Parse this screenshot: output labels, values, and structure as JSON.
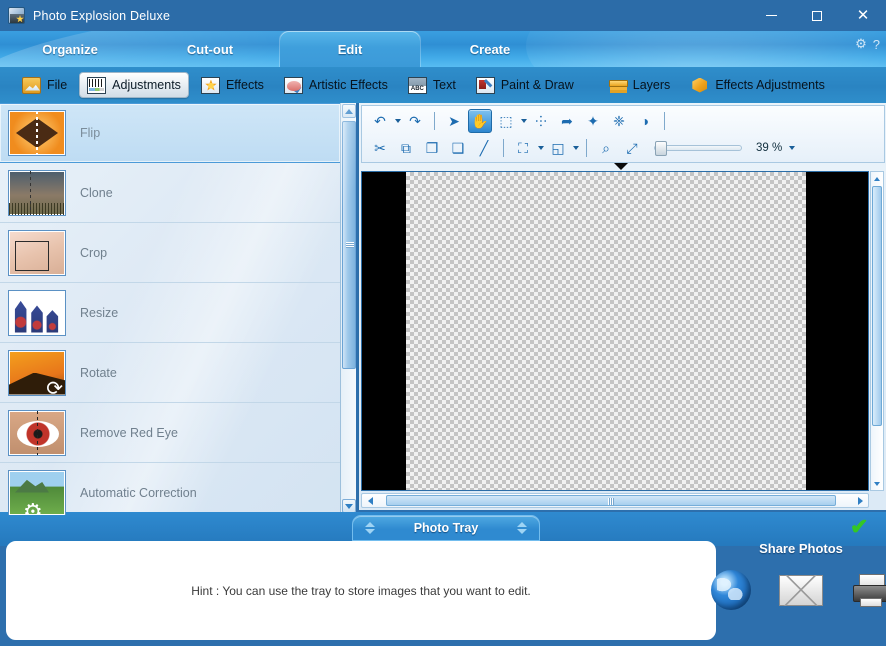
{
  "window": {
    "title": "Photo Explosion Deluxe",
    "app_icon": "photo-app-icon",
    "minimize_label": "—",
    "maximize_label": "❐",
    "close_label": "✕"
  },
  "nav": {
    "tabs": [
      {
        "label": "Organize",
        "active": false
      },
      {
        "label": "Cut-out",
        "active": false
      },
      {
        "label": "Edit",
        "active": true
      },
      {
        "label": "Create",
        "active": false
      }
    ],
    "settings_icon": "gear-icon",
    "help_icon": "question-mark-icon",
    "help_label": "?"
  },
  "ribbon": {
    "items": [
      {
        "label": "File",
        "icon": "file-icon",
        "selected": false
      },
      {
        "label": "Adjustments",
        "icon": "adjustments-histogram-icon",
        "selected": true
      },
      {
        "label": "Effects",
        "icon": "effects-star-icon",
        "selected": false
      },
      {
        "label": "Artistic Effects",
        "icon": "artistic-effects-palette-icon",
        "selected": false
      },
      {
        "label": "Text",
        "icon": "text-abc-icon",
        "selected": false
      },
      {
        "label": "Paint & Draw",
        "icon": "paint-draw-icon",
        "selected": false
      },
      {
        "label": "Layers",
        "icon": "layers-icon",
        "selected": false
      },
      {
        "label": "Effects Adjustments",
        "icon": "effects-adjustments-cube-icon",
        "selected": false
      }
    ]
  },
  "tools": {
    "items": [
      {
        "label": "Flip",
        "thumb": "flip-thumb",
        "selected": true
      },
      {
        "label": "Clone",
        "thumb": "clone-thumb",
        "selected": false
      },
      {
        "label": "Crop",
        "thumb": "crop-thumb",
        "selected": false
      },
      {
        "label": "Resize",
        "thumb": "resize-thumb",
        "selected": false
      },
      {
        "label": "Rotate",
        "thumb": "rotate-thumb",
        "selected": false
      },
      {
        "label": "Remove Red Eye",
        "thumb": "red-eye-thumb",
        "selected": false
      },
      {
        "label": "Automatic Correction",
        "thumb": "auto-correction-thumb",
        "selected": false
      }
    ],
    "bottom_buttons": [
      {
        "icon": "add-image-icon"
      },
      {
        "icon": "import-image-icon"
      }
    ],
    "scroll_up": "▲",
    "scroll_down": "▼"
  },
  "editor_toolbar": {
    "row1": [
      {
        "icon": "undo-icon",
        "glyph": "↶",
        "has_caret": true,
        "active": false
      },
      {
        "icon": "redo-icon",
        "glyph": "↷",
        "has_caret": false,
        "active": false
      },
      {
        "icon": "separator",
        "glyph": "",
        "has_caret": false,
        "active": false
      },
      {
        "icon": "pointer-select-icon",
        "glyph": "➤",
        "has_caret": false,
        "active": false
      },
      {
        "icon": "hand-pan-icon",
        "glyph": "✋",
        "has_caret": false,
        "active": true
      },
      {
        "icon": "rectangle-marquee-icon",
        "glyph": "⬚",
        "has_caret": true,
        "active": false
      },
      {
        "icon": "lasso-polygon-icon",
        "glyph": "⸭",
        "has_caret": false,
        "active": false
      },
      {
        "icon": "magnetic-lasso-icon",
        "glyph": "➦",
        "has_caret": false,
        "active": false
      },
      {
        "icon": "magic-wand-icon",
        "glyph": "✦",
        "has_caret": false,
        "active": false
      },
      {
        "icon": "magic-eraser-icon",
        "glyph": "❈",
        "has_caret": false,
        "active": false
      },
      {
        "icon": "invert-selection-icon",
        "glyph": "◑",
        "has_caret": false,
        "active": false
      }
    ],
    "row2": [
      {
        "icon": "cut-scissors-icon",
        "glyph": "✂",
        "has_caret": false,
        "active": false
      },
      {
        "icon": "copy-icon",
        "glyph": "⧉",
        "has_caret": false,
        "active": false
      },
      {
        "icon": "paste-icon",
        "glyph": "❐",
        "has_caret": false,
        "active": false
      },
      {
        "icon": "paste-into-icon",
        "glyph": "❑",
        "has_caret": false,
        "active": false
      },
      {
        "icon": "eraser-icon",
        "glyph": "∕",
        "has_caret": false,
        "active": false
      },
      {
        "icon": "separator",
        "glyph": "",
        "has_caret": false,
        "active": false
      },
      {
        "icon": "transform-icon",
        "glyph": "⛶",
        "has_caret": true,
        "active": false
      },
      {
        "icon": "arrange-layers-icon",
        "glyph": "◱",
        "has_caret": true,
        "active": false
      },
      {
        "icon": "separator",
        "glyph": "",
        "has_caret": false,
        "active": false
      },
      {
        "icon": "zoom-tool-icon",
        "glyph": "⌕",
        "has_caret": false,
        "active": false
      },
      {
        "icon": "fit-to-screen-icon",
        "glyph": "⤢",
        "has_caret": false,
        "active": false
      }
    ],
    "zoom": {
      "value": "39 %",
      "percent": 39,
      "slider_name": "zoom-slider",
      "dropdown_icon": "chevron-down-icon"
    },
    "expand_icon": "expand-panel-arrow-icon"
  },
  "canvas": {
    "background_color": "#000000",
    "transparency_checker": true,
    "hscroll_name": "canvas-horizontal-scrollbar",
    "vscroll_name": "canvas-vertical-scrollbar"
  },
  "tray": {
    "tab_label": "Photo Tray",
    "hint": "Hint : You can use the tray to store images that you want to edit.",
    "confirm_icon": "green-check-icon",
    "confirm_glyph": "✔"
  },
  "share": {
    "title": "Share Photos",
    "items": [
      {
        "icon": "globe-web-icon",
        "name": "share-to-web"
      },
      {
        "icon": "envelope-email-icon",
        "name": "share-by-email"
      },
      {
        "icon": "printer-icon",
        "name": "print-photos"
      }
    ]
  },
  "colors": {
    "accent": "#2f8ecb",
    "titlebar": "#2c6ca8",
    "tab_active": "#3f9fdc",
    "panel_bg": "#dfeaf5",
    "canvas_bg": "#000000",
    "check_green": "#34c724"
  }
}
